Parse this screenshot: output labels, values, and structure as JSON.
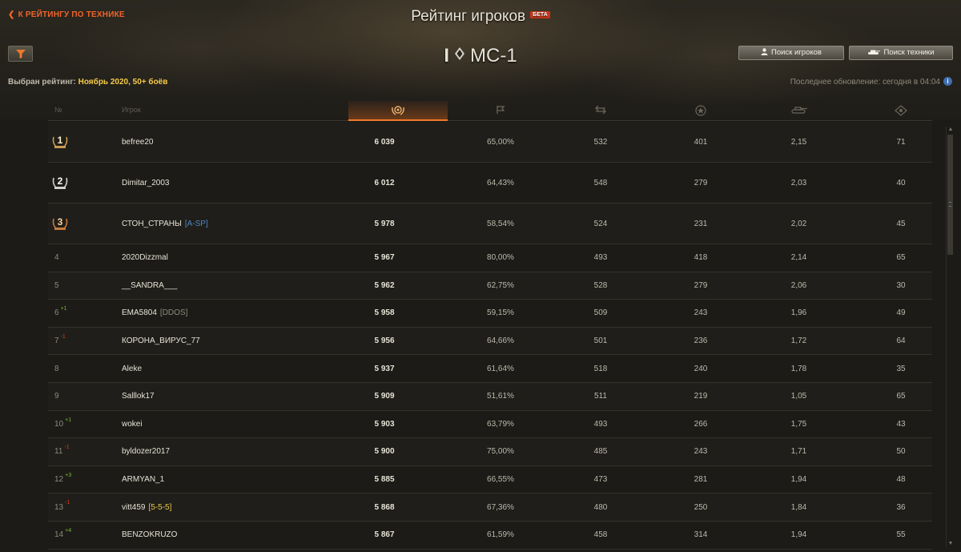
{
  "header": {
    "back_label": "К РЕЙТИНГУ ПО ТЕХНИКЕ",
    "title": "Рейтинг игроков",
    "beta": "БЕТА",
    "vehicle_tier": "I",
    "vehicle_name": "МС-1",
    "search_players": "Поиск игроков",
    "search_vehicles": "Поиск техники",
    "selected_label": "Выбран рейтинг: ",
    "selected_value": "Ноябрь 2020, 50+ боёв",
    "last_update": "Последнее обновление: сегодня в 04:04",
    "info": "i"
  },
  "columns": {
    "rank": "№",
    "player": "Игрок",
    "icons": [
      "rating-laurel-icon",
      "flag-icon",
      "battles-icon",
      "star-xp-icon",
      "tank-kd-icon",
      "spotted-icon"
    ]
  },
  "colors": {
    "accent": "#f0782a",
    "positive": "#79b83a",
    "negative": "#d04020",
    "clan_blue": "#4f86c4",
    "clan_gold": "#e6c845"
  },
  "rows": [
    {
      "rank": "1",
      "name": "befree20",
      "clan": "",
      "score": "6 039",
      "win": "65,00%",
      "battles": "532",
      "xp": "401",
      "kd": "2,15",
      "spot": "71"
    },
    {
      "rank": "2",
      "name": "Dimitar_2003",
      "clan": "",
      "score": "6 012",
      "win": "64,43%",
      "battles": "548",
      "xp": "279",
      "kd": "2,03",
      "spot": "40"
    },
    {
      "rank": "3",
      "name": "СТОН_СТРАНЫ",
      "clan": "[A-SP]",
      "score": "5 978",
      "win": "58,54%",
      "battles": "524",
      "xp": "231",
      "kd": "2,02",
      "spot": "45"
    },
    {
      "rank": "4",
      "name": "2020Dizzmal",
      "clan": "",
      "score": "5 967",
      "win": "80,00%",
      "battles": "493",
      "xp": "418",
      "kd": "2,14",
      "spot": "65"
    },
    {
      "rank": "5",
      "name": "__SANDRA___",
      "clan": "",
      "score": "5 962",
      "win": "62,75%",
      "battles": "528",
      "xp": "279",
      "kd": "2,06",
      "spot": "30"
    },
    {
      "rank": "6",
      "delta": "+1",
      "name": "EMA5804",
      "clan": "[DDOS]",
      "score": "5 958",
      "win": "59,15%",
      "battles": "509",
      "xp": "243",
      "kd": "1,96",
      "spot": "49"
    },
    {
      "rank": "7",
      "delta": "-1",
      "name": "КОРОНА_ВИРУС_77",
      "clan": "",
      "score": "5 956",
      "win": "64,66%",
      "battles": "501",
      "xp": "236",
      "kd": "1,72",
      "spot": "64"
    },
    {
      "rank": "8",
      "name": "Aleke",
      "clan": "",
      "score": "5 937",
      "win": "61,64%",
      "battles": "518",
      "xp": "240",
      "kd": "1,78",
      "spot": "35"
    },
    {
      "rank": "9",
      "name": "Salllok17",
      "clan": "",
      "score": "5 909",
      "win": "51,61%",
      "battles": "511",
      "xp": "219",
      "kd": "1,05",
      "spot": "65"
    },
    {
      "rank": "10",
      "delta": "+1",
      "name": "wokei",
      "clan": "",
      "score": "5 903",
      "win": "63,79%",
      "battles": "493",
      "xp": "266",
      "kd": "1,75",
      "spot": "43"
    },
    {
      "rank": "11",
      "delta": "-1",
      "name": "byldozer2017",
      "clan": "",
      "score": "5 900",
      "win": "75,00%",
      "battles": "485",
      "xp": "243",
      "kd": "1,71",
      "spot": "50"
    },
    {
      "rank": "12",
      "delta": "+3",
      "name": "ARMYAN_1",
      "clan": "",
      "score": "5 885",
      "win": "66,55%",
      "battles": "473",
      "xp": "281",
      "kd": "1,94",
      "spot": "48"
    },
    {
      "rank": "13",
      "delta": "-1",
      "name": "vitt459",
      "clan": "[5-5-5]",
      "score": "5 868",
      "win": "67,36%",
      "battles": "480",
      "xp": "250",
      "kd": "1,84",
      "spot": "36"
    },
    {
      "rank": "14",
      "delta": "+4",
      "name": "BENZOKRUZO",
      "clan": "",
      "score": "5 867",
      "win": "61,59%",
      "battles": "458",
      "xp": "314",
      "kd": "1,94",
      "spot": "55"
    }
  ]
}
